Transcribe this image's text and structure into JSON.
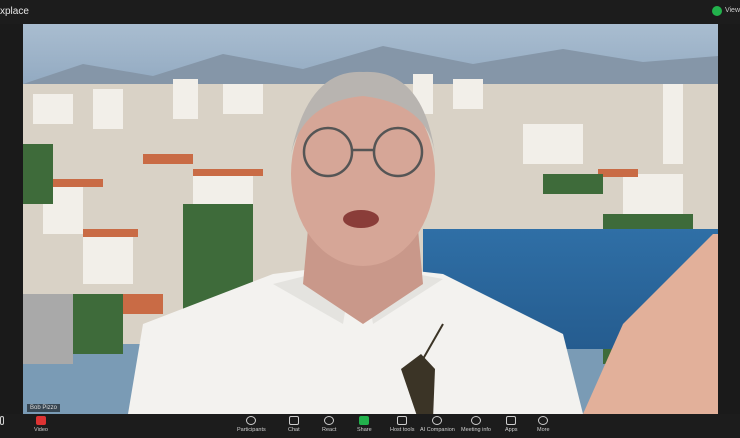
{
  "window": {
    "title": "xplace",
    "view_label": "View"
  },
  "participant": {
    "name": "Bob Pizzo"
  },
  "toolbar": {
    "audio_label": "",
    "video_label": "Video",
    "participants_label": "Participants",
    "chat_label": "Chat",
    "react_label": "React",
    "share_label": "Share",
    "host_tools_label": "Host tools",
    "ai_companion_label": "AI Companion",
    "meeting_info_label": "Meeting info",
    "apps_label": "Apps",
    "more_label": "More"
  },
  "icons": {
    "security": "shield-check-icon",
    "video": "video-off-icon",
    "participants": "people-icon",
    "chat": "chat-bubble-icon",
    "react": "heart-icon",
    "share": "share-screen-icon",
    "host_tools": "shield-icon",
    "ai_companion": "sparkle-icon",
    "meeting_info": "info-icon",
    "apps": "apps-icon",
    "more": "more-icon"
  },
  "colors": {
    "share_accent": "#22b24c",
    "video_off": "#dd3333",
    "bar_bg": "#1c1c1c"
  }
}
